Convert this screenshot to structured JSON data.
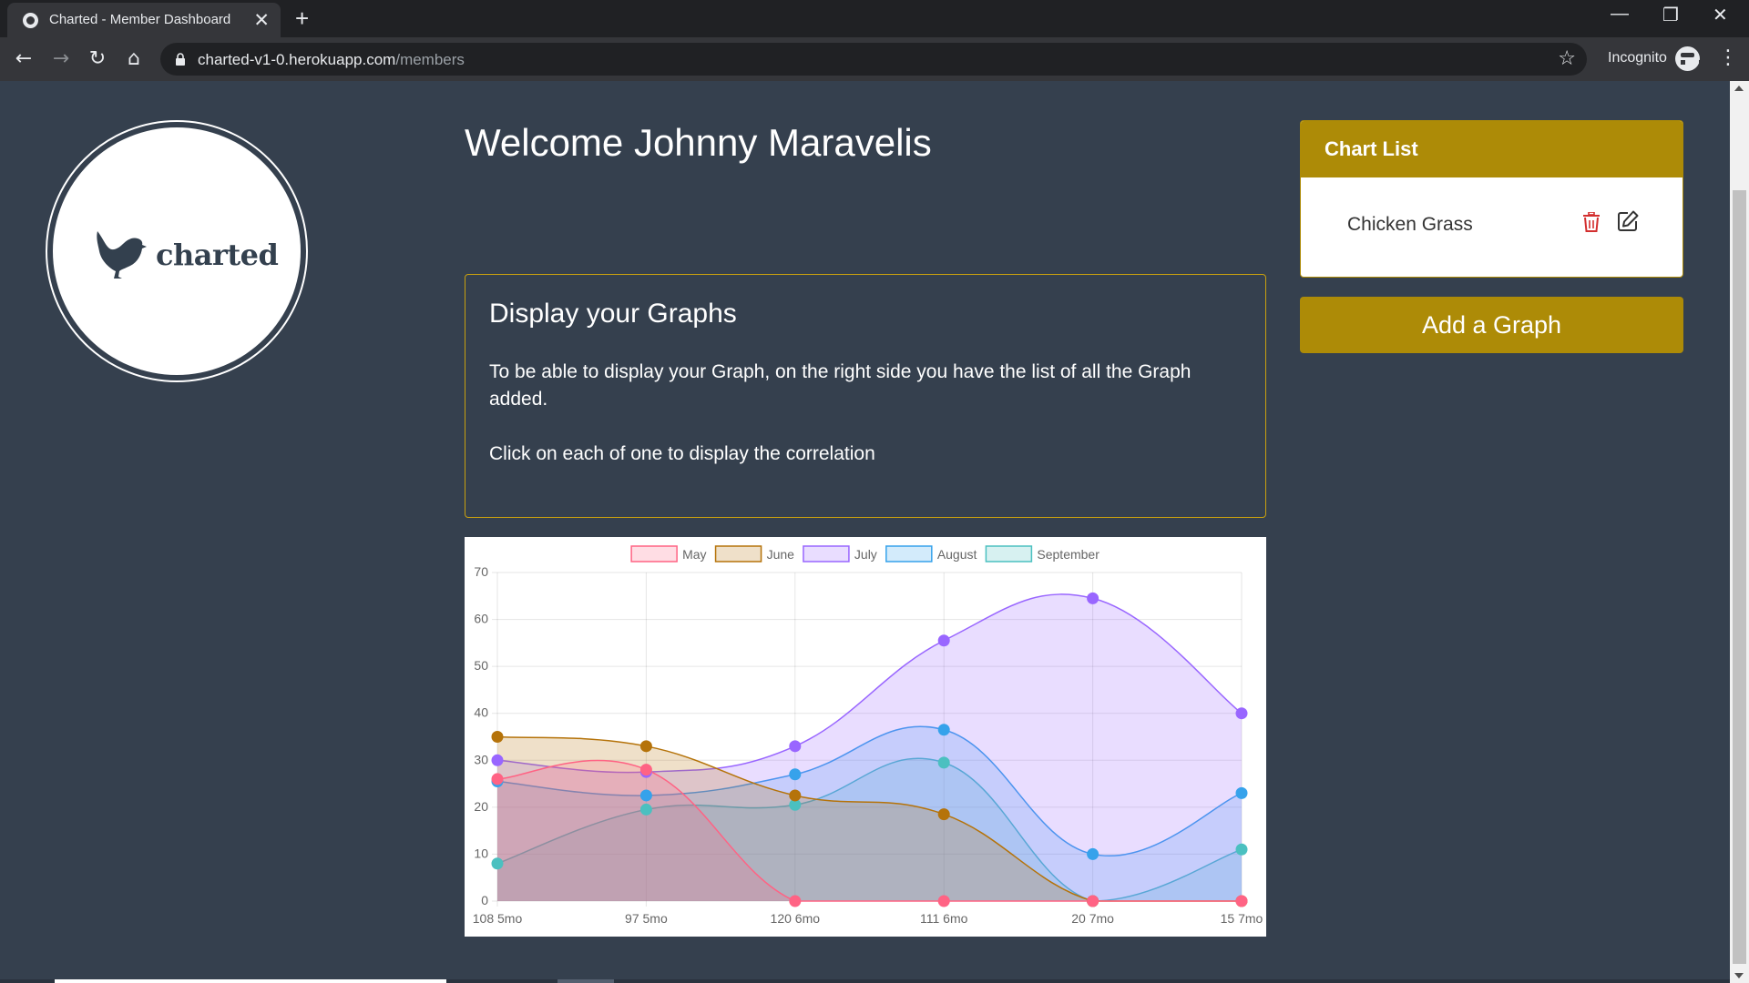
{
  "browser": {
    "tab_title": "Charted - Member Dashboard",
    "tab_close": "✕",
    "new_tab": "+",
    "url_host": "charted-v1-0.herokuapp.com",
    "url_path": "/members",
    "incognito_label": "Incognito",
    "window_controls": {
      "minimize": "—",
      "restore": "❐",
      "close": "✕"
    }
  },
  "logo": {
    "text": "charted"
  },
  "welcome": "Welcome Johnny Maravelis",
  "info": {
    "title": "Display your Graphs",
    "text1": "To be able to display your Graph, on the right side you have the list of all the Graph added.",
    "text2": "Click on each of one to display the correlation"
  },
  "chart_list": {
    "title": "Chart List",
    "items": [
      {
        "label": "Chicken Grass"
      }
    ]
  },
  "add_graph_label": "Add a Graph",
  "chart_data": {
    "type": "area",
    "categories": [
      "108 5mo",
      "97 5mo",
      "120 6mo",
      "111 6mo",
      "20 7mo",
      "15 7mo"
    ],
    "ylim": [
      0,
      70
    ],
    "yticks": [
      0,
      10,
      20,
      30,
      40,
      50,
      60,
      70
    ],
    "grid": true,
    "legend": "top",
    "series": [
      {
        "name": "May",
        "values": [
          26,
          28,
          0,
          0,
          0,
          0
        ],
        "color": "#ff6384"
      },
      {
        "name": "June",
        "values": [
          35,
          33,
          22.5,
          18.5,
          0,
          0
        ],
        "color": "#b5730a"
      },
      {
        "name": "July",
        "values": [
          30,
          27.5,
          33,
          55.5,
          64.5,
          40
        ],
        "color": "#9966ff"
      },
      {
        "name": "August",
        "values": [
          25.5,
          22.5,
          27,
          36.5,
          10,
          23
        ],
        "color": "#36a2eb"
      },
      {
        "name": "September",
        "values": [
          8,
          19.5,
          20.5,
          29.5,
          0,
          11
        ],
        "color": "#4bc0c0"
      }
    ]
  }
}
